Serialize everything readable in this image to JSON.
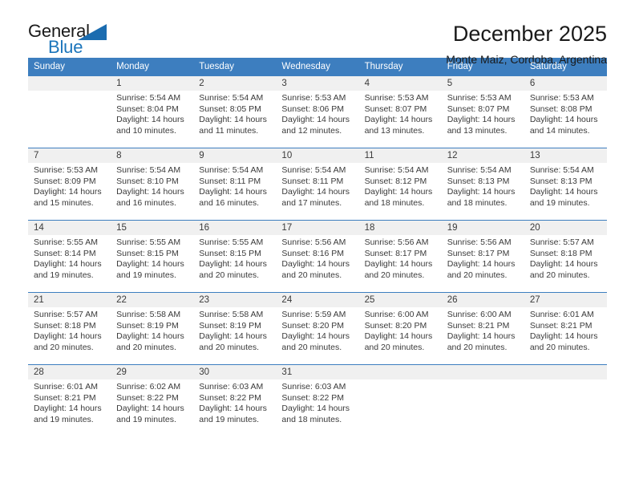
{
  "logo": {
    "word_one": "General",
    "word_two": "Blue",
    "triangle": "blue-triangle",
    "primary_color": "#1b75bb"
  },
  "header": {
    "title": "December 2025",
    "subtitle": "Monte Maiz, Cordoba, Argentina"
  },
  "theme": {
    "header_blue": "#3d7ebf",
    "daynum_bg": "#f0f0f0",
    "text": "#3a3a3a"
  },
  "calendar": {
    "weekday_headers": [
      "Sunday",
      "Monday",
      "Tuesday",
      "Wednesday",
      "Thursday",
      "Friday",
      "Saturday"
    ],
    "labels": {
      "sunrise": "Sunrise:",
      "sunset": "Sunset:",
      "daylight": "Daylight:"
    },
    "weeks": [
      [
        {
          "day": "",
          "sunrise": "",
          "sunset": "",
          "daylight": "",
          "empty": true
        },
        {
          "day": "1",
          "sunrise": "Sunrise: 5:54 AM",
          "sunset": "Sunset: 8:04 PM",
          "daylight": "Daylight: 14 hours and 10 minutes."
        },
        {
          "day": "2",
          "sunrise": "Sunrise: 5:54 AM",
          "sunset": "Sunset: 8:05 PM",
          "daylight": "Daylight: 14 hours and 11 minutes."
        },
        {
          "day": "3",
          "sunrise": "Sunrise: 5:53 AM",
          "sunset": "Sunset: 8:06 PM",
          "daylight": "Daylight: 14 hours and 12 minutes."
        },
        {
          "day": "4",
          "sunrise": "Sunrise: 5:53 AM",
          "sunset": "Sunset: 8:07 PM",
          "daylight": "Daylight: 14 hours and 13 minutes."
        },
        {
          "day": "5",
          "sunrise": "Sunrise: 5:53 AM",
          "sunset": "Sunset: 8:07 PM",
          "daylight": "Daylight: 14 hours and 13 minutes."
        },
        {
          "day": "6",
          "sunrise": "Sunrise: 5:53 AM",
          "sunset": "Sunset: 8:08 PM",
          "daylight": "Daylight: 14 hours and 14 minutes."
        }
      ],
      [
        {
          "day": "7",
          "sunrise": "Sunrise: 5:53 AM",
          "sunset": "Sunset: 8:09 PM",
          "daylight": "Daylight: 14 hours and 15 minutes."
        },
        {
          "day": "8",
          "sunrise": "Sunrise: 5:54 AM",
          "sunset": "Sunset: 8:10 PM",
          "daylight": "Daylight: 14 hours and 16 minutes."
        },
        {
          "day": "9",
          "sunrise": "Sunrise: 5:54 AM",
          "sunset": "Sunset: 8:11 PM",
          "daylight": "Daylight: 14 hours and 16 minutes."
        },
        {
          "day": "10",
          "sunrise": "Sunrise: 5:54 AM",
          "sunset": "Sunset: 8:11 PM",
          "daylight": "Daylight: 14 hours and 17 minutes."
        },
        {
          "day": "11",
          "sunrise": "Sunrise: 5:54 AM",
          "sunset": "Sunset: 8:12 PM",
          "daylight": "Daylight: 14 hours and 18 minutes."
        },
        {
          "day": "12",
          "sunrise": "Sunrise: 5:54 AM",
          "sunset": "Sunset: 8:13 PM",
          "daylight": "Daylight: 14 hours and 18 minutes."
        },
        {
          "day": "13",
          "sunrise": "Sunrise: 5:54 AM",
          "sunset": "Sunset: 8:13 PM",
          "daylight": "Daylight: 14 hours and 19 minutes."
        }
      ],
      [
        {
          "day": "14",
          "sunrise": "Sunrise: 5:55 AM",
          "sunset": "Sunset: 8:14 PM",
          "daylight": "Daylight: 14 hours and 19 minutes."
        },
        {
          "day": "15",
          "sunrise": "Sunrise: 5:55 AM",
          "sunset": "Sunset: 8:15 PM",
          "daylight": "Daylight: 14 hours and 19 minutes."
        },
        {
          "day": "16",
          "sunrise": "Sunrise: 5:55 AM",
          "sunset": "Sunset: 8:15 PM",
          "daylight": "Daylight: 14 hours and 20 minutes."
        },
        {
          "day": "17",
          "sunrise": "Sunrise: 5:56 AM",
          "sunset": "Sunset: 8:16 PM",
          "daylight": "Daylight: 14 hours and 20 minutes."
        },
        {
          "day": "18",
          "sunrise": "Sunrise: 5:56 AM",
          "sunset": "Sunset: 8:17 PM",
          "daylight": "Daylight: 14 hours and 20 minutes."
        },
        {
          "day": "19",
          "sunrise": "Sunrise: 5:56 AM",
          "sunset": "Sunset: 8:17 PM",
          "daylight": "Daylight: 14 hours and 20 minutes."
        },
        {
          "day": "20",
          "sunrise": "Sunrise: 5:57 AM",
          "sunset": "Sunset: 8:18 PM",
          "daylight": "Daylight: 14 hours and 20 minutes."
        }
      ],
      [
        {
          "day": "21",
          "sunrise": "Sunrise: 5:57 AM",
          "sunset": "Sunset: 8:18 PM",
          "daylight": "Daylight: 14 hours and 20 minutes."
        },
        {
          "day": "22",
          "sunrise": "Sunrise: 5:58 AM",
          "sunset": "Sunset: 8:19 PM",
          "daylight": "Daylight: 14 hours and 20 minutes."
        },
        {
          "day": "23",
          "sunrise": "Sunrise: 5:58 AM",
          "sunset": "Sunset: 8:19 PM",
          "daylight": "Daylight: 14 hours and 20 minutes."
        },
        {
          "day": "24",
          "sunrise": "Sunrise: 5:59 AM",
          "sunset": "Sunset: 8:20 PM",
          "daylight": "Daylight: 14 hours and 20 minutes."
        },
        {
          "day": "25",
          "sunrise": "Sunrise: 6:00 AM",
          "sunset": "Sunset: 8:20 PM",
          "daylight": "Daylight: 14 hours and 20 minutes."
        },
        {
          "day": "26",
          "sunrise": "Sunrise: 6:00 AM",
          "sunset": "Sunset: 8:21 PM",
          "daylight": "Daylight: 14 hours and 20 minutes."
        },
        {
          "day": "27",
          "sunrise": "Sunrise: 6:01 AM",
          "sunset": "Sunset: 8:21 PM",
          "daylight": "Daylight: 14 hours and 20 minutes."
        }
      ],
      [
        {
          "day": "28",
          "sunrise": "Sunrise: 6:01 AM",
          "sunset": "Sunset: 8:21 PM",
          "daylight": "Daylight: 14 hours and 19 minutes."
        },
        {
          "day": "29",
          "sunrise": "Sunrise: 6:02 AM",
          "sunset": "Sunset: 8:22 PM",
          "daylight": "Daylight: 14 hours and 19 minutes."
        },
        {
          "day": "30",
          "sunrise": "Sunrise: 6:03 AM",
          "sunset": "Sunset: 8:22 PM",
          "daylight": "Daylight: 14 hours and 19 minutes."
        },
        {
          "day": "31",
          "sunrise": "Sunrise: 6:03 AM",
          "sunset": "Sunset: 8:22 PM",
          "daylight": "Daylight: 14 hours and 18 minutes."
        },
        {
          "day": "",
          "sunrise": "",
          "sunset": "",
          "daylight": "",
          "empty": true
        },
        {
          "day": "",
          "sunrise": "",
          "sunset": "",
          "daylight": "",
          "empty": true
        },
        {
          "day": "",
          "sunrise": "",
          "sunset": "",
          "daylight": "",
          "empty": true
        }
      ]
    ]
  }
}
